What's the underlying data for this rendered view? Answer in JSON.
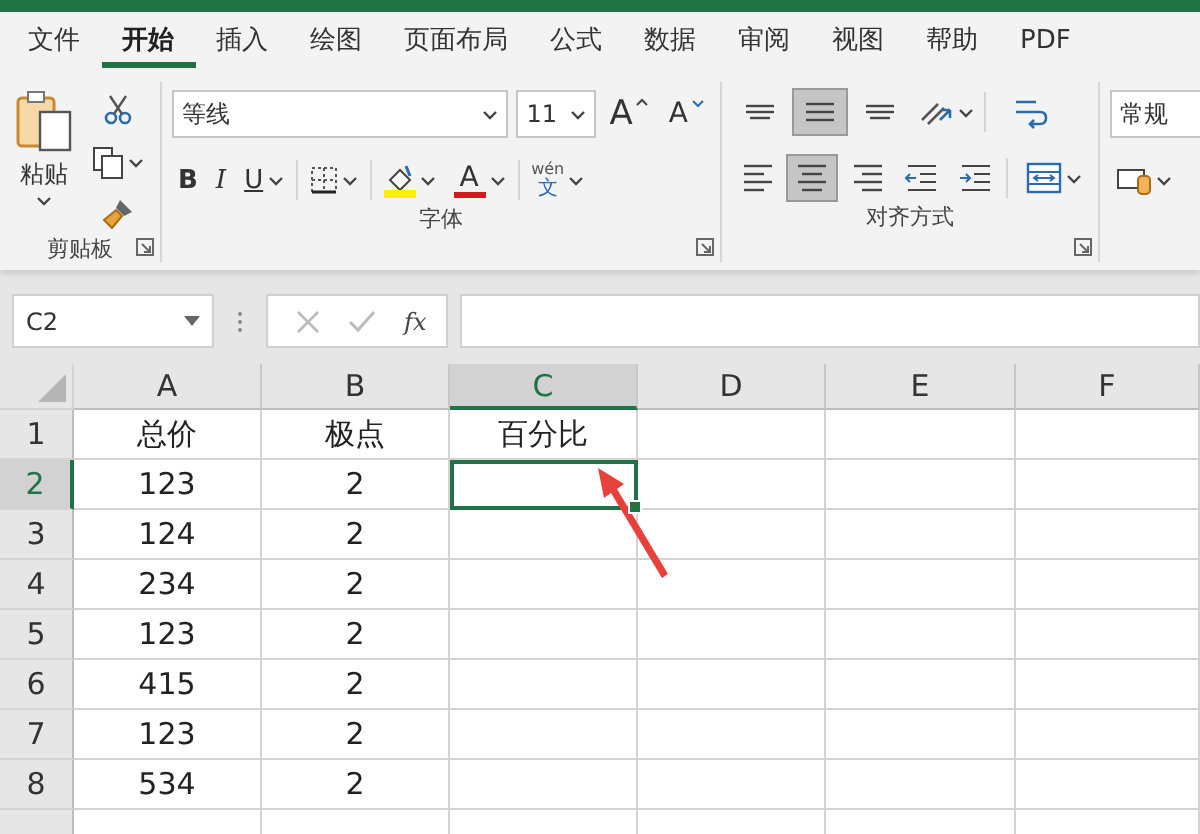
{
  "ribbon_tabs": [
    {
      "label": "文件",
      "selected": false
    },
    {
      "label": "开始",
      "selected": true
    },
    {
      "label": "插入",
      "selected": false
    },
    {
      "label": "绘图",
      "selected": false
    },
    {
      "label": "页面布局",
      "selected": false
    },
    {
      "label": "公式",
      "selected": false
    },
    {
      "label": "数据",
      "selected": false
    },
    {
      "label": "审阅",
      "selected": false
    },
    {
      "label": "视图",
      "selected": false
    },
    {
      "label": "帮助",
      "selected": false
    },
    {
      "label": "PDF",
      "selected": false
    }
  ],
  "clipboard": {
    "paste": "粘贴",
    "group": "剪贴板"
  },
  "font": {
    "name": "等线",
    "size": "11",
    "grow": "A",
    "shrink": "A",
    "bold": "B",
    "italic": "I",
    "underline": "U",
    "font_color": "A",
    "phonetic_top": "wén",
    "phonetic_bottom": "文",
    "group": "字体"
  },
  "alignment": {
    "group": "对齐方式",
    "vertical": [
      {
        "kind": "top",
        "selected": false
      },
      {
        "kind": "middle",
        "selected": true
      },
      {
        "kind": "bottom",
        "selected": false
      }
    ],
    "horizontal": [
      {
        "kind": "left",
        "selected": false
      },
      {
        "kind": "center",
        "selected": true
      },
      {
        "kind": "right",
        "selected": false
      }
    ]
  },
  "number": {
    "format": "常规"
  },
  "formula_bar": {
    "name_box": "C2",
    "function": "fx"
  },
  "sheet": {
    "columns": [
      {
        "label": "A",
        "selected": false
      },
      {
        "label": "B",
        "selected": false
      },
      {
        "label": "C",
        "selected": true
      },
      {
        "label": "D",
        "selected": false
      },
      {
        "label": "E",
        "selected": false
      },
      {
        "label": "F",
        "selected": false
      }
    ],
    "rows": [
      {
        "header": "1",
        "selected": false,
        "cells": [
          "总价",
          "极点",
          "百分比"
        ]
      },
      {
        "header": "2",
        "selected": true,
        "cells": [
          "123",
          "2"
        ]
      },
      {
        "header": "3",
        "selected": false,
        "cells": [
          "124",
          "2"
        ]
      },
      {
        "header": "4",
        "selected": false,
        "cells": [
          "234",
          "2"
        ]
      },
      {
        "header": "5",
        "selected": false,
        "cells": [
          "123",
          "2"
        ]
      },
      {
        "header": "6",
        "selected": false,
        "cells": [
          "415",
          "2"
        ]
      },
      {
        "header": "7",
        "selected": false,
        "cells": [
          "123",
          "2"
        ]
      },
      {
        "header": "8",
        "selected": false,
        "cells": [
          "534",
          "2"
        ]
      }
    ]
  }
}
